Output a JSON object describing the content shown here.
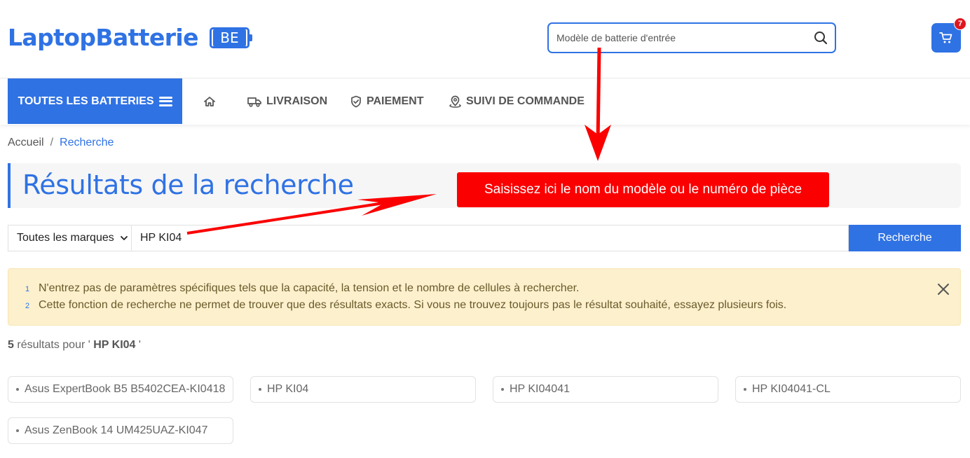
{
  "brand": {
    "name": "LaptopBatterie",
    "badge": "BE",
    "color": "#2f72e4"
  },
  "header": {
    "search_placeholder": "Modèle de batterie d'entrée",
    "cart_count": "7"
  },
  "nav": {
    "all_batteries": "TOUTES LES BATTERIES",
    "items": [
      {
        "label": "",
        "icon": "home-icon"
      },
      {
        "label": "LIVRAISON",
        "icon": "truck-icon"
      },
      {
        "label": "PAIEMENT",
        "icon": "shield-icon"
      },
      {
        "label": "SUIVI DE COMMANDE",
        "icon": "location-icon"
      }
    ]
  },
  "breadcrumb": {
    "home": "Accueil",
    "separator": "/",
    "current": "Recherche"
  },
  "main": {
    "title": "Résultats de la recherche",
    "annotation": "Saisissez ici le nom du modèle ou le numéro de pièce",
    "search": {
      "brand_selected": "Toutes les marques",
      "query": "HP KI04",
      "submit_label": "Recherche"
    },
    "notice": {
      "lines": [
        {
          "num": "1",
          "text": "N'entrez pas de paramètres spécifiques tels que la capacité, la tension et le nombre de cellules à rechercher."
        },
        {
          "num": "2",
          "text": "Cette fonction de recherche ne permet de trouver que des résultats exacts. Si vous ne trouvez toujours pas le résultat souhaité, essayez plusieurs fois."
        }
      ]
    },
    "results": {
      "count": "5",
      "prefix": "résultats pour '",
      "query": "HP KI04",
      "suffix": "'",
      "items": [
        "Asus ExpertBook B5 B5402CEA-KI0418",
        "HP KI04",
        "HP KI04041",
        "HP KI04041-CL",
        "Asus ZenBook 14 UM425UAZ-KI047"
      ]
    }
  },
  "colors": {
    "accent": "#2f72e4",
    "annotation_red": "#fb0000",
    "notice_bg": "#fcf0cd",
    "badge_red": "#e0161f"
  }
}
